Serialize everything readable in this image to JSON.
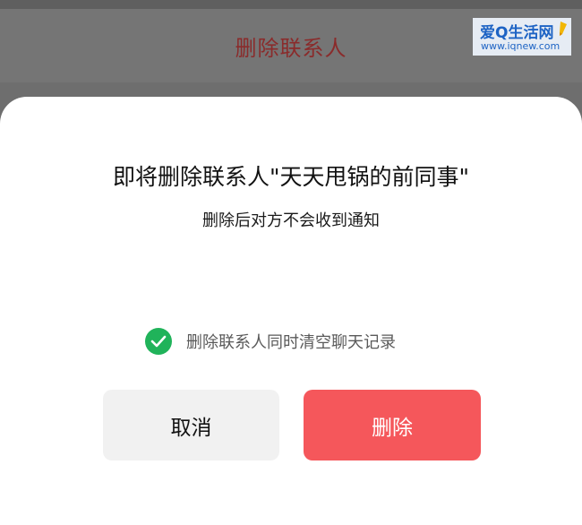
{
  "backdrop": {
    "title": "删除联系人"
  },
  "watermark": {
    "name": "爱Q生活网",
    "url": "www.iqnew.com"
  },
  "dialog": {
    "title": "即将删除联系人\"天天甩锅的前同事\"",
    "subtitle": "删除后对方不会收到通知",
    "checkbox": {
      "label": "删除联系人同时清空聊天记录",
      "checked": true,
      "icon": "check-circle-icon",
      "color": "#20b35a"
    },
    "cancel_label": "取消",
    "delete_label": "删除",
    "delete_color": "#f5575b"
  }
}
